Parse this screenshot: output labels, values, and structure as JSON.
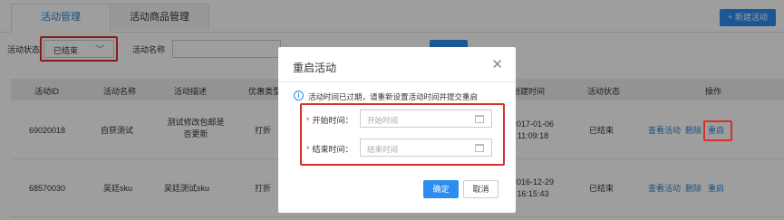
{
  "tabs": [
    {
      "label": "活动管理"
    },
    {
      "label": "活动商品管理"
    }
  ],
  "new_button": "+ 新建活动",
  "filters": {
    "status_label": "活动状态",
    "status_value": "已结束",
    "name_label": "活动名称",
    "name_value": ""
  },
  "table": {
    "headers": [
      "活动ID",
      "活动名称",
      "活动描述",
      "优惠类型",
      "创建时间",
      "活动状态",
      "操作"
    ],
    "rows": [
      {
        "id": "69020018",
        "name": "自获测试",
        "desc_line1": "测试修改包邮是",
        "desc_line2": "否更新",
        "type": "打折",
        "time_line1": "2017-01-06",
        "time_line2": "11:09:18",
        "status": "已结束",
        "actions": [
          "查看活动",
          "删除",
          "重启"
        ]
      },
      {
        "id": "68570030",
        "name": "吴廷sku",
        "desc_line1": "吴廷测试sku",
        "desc_line2": "",
        "type": "打折",
        "time_line1": "2016-12-29",
        "time_line2": "16:15:43",
        "status": "已结束",
        "actions": [
          "查看活动",
          "删除",
          "重启"
        ]
      }
    ]
  },
  "modal": {
    "title": "重启活动",
    "notice": "活动时间已过期，请重新设置活动时间并提交重启",
    "required_mark": "*",
    "start_label": "开始时间：",
    "start_placeholder": "开始时间",
    "end_label": "结束时间：",
    "end_placeholder": "结束时间",
    "ok": "确定",
    "cancel": "取消",
    "close_glyph": "✕",
    "info_glyph": "i"
  },
  "colors": {
    "primary": "#2d8cf0",
    "highlight_border": "#d9302e",
    "link": "#2a87d6"
  },
  "icons": [
    "chevron-down-icon",
    "close-icon",
    "info-icon",
    "calendar-icon"
  ]
}
